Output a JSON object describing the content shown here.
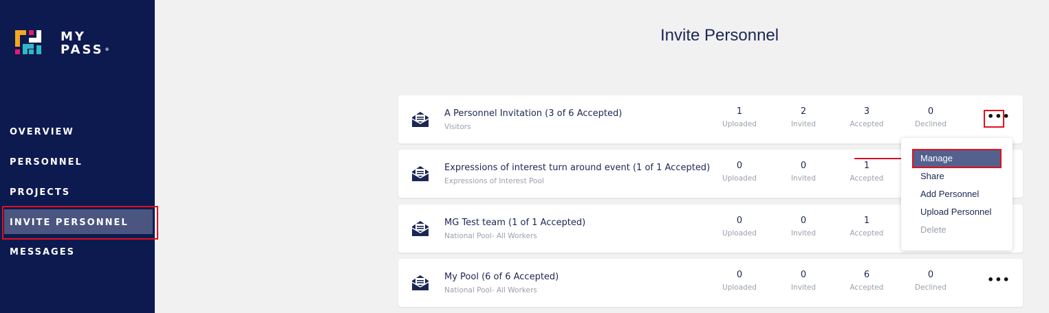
{
  "brand": {
    "line1": "MY",
    "line2": "PASS",
    "tm": "®"
  },
  "nav": {
    "items": [
      {
        "label": "OVERVIEW"
      },
      {
        "label": "PERSONNEL"
      },
      {
        "label": "PROJECTS"
      },
      {
        "label": "INVITE PERSONNEL",
        "active": true
      },
      {
        "label": "MESSAGES"
      }
    ]
  },
  "page": {
    "title": "Invite Personnel"
  },
  "stat_labels": {
    "uploaded": "Uploaded",
    "invited": "Invited",
    "accepted": "Accepted",
    "declined": "Declined"
  },
  "invitations": [
    {
      "name": "A Personnel Invitation (3 of 6 Accepted)",
      "pool": "Visitors",
      "uploaded": "1",
      "invited": "2",
      "accepted": "3",
      "declined": "0"
    },
    {
      "name": "Expressions of interest turn around event (1 of 1 Accepted)",
      "pool": "Expressions of Interest Pool",
      "uploaded": "0",
      "invited": "0",
      "accepted": "1"
    },
    {
      "name": "MG Test team (1 of 1 Accepted)",
      "pool": "National Pool- All Workers",
      "uploaded": "0",
      "invited": "0",
      "accepted": "1"
    },
    {
      "name": "My Pool (6 of 6 Accepted)",
      "pool": "National Pool- All Workers",
      "uploaded": "0",
      "invited": "0",
      "accepted": "6",
      "declined": "0"
    }
  ],
  "menu": {
    "items": [
      {
        "label": "Manage",
        "highlighted": true
      },
      {
        "label": "Share"
      },
      {
        "label": "Add Personnel"
      },
      {
        "label": "Upload Personnel"
      },
      {
        "label": "Delete",
        "disabled": true
      }
    ]
  },
  "colors": {
    "sidebar": "#0d1a4f",
    "accent": "#54618f",
    "highlight": "#e0101e",
    "text": "#1b2654"
  },
  "icons": {
    "row_icon": "envelope-open-icon",
    "row_menu": "more-horizontal-icon"
  }
}
